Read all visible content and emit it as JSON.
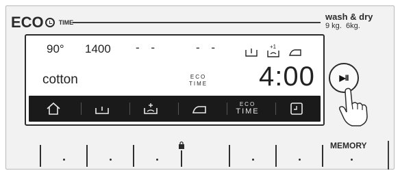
{
  "brand": {
    "eco": "ECO",
    "time": "TIME"
  },
  "capacity": {
    "title": "wash & dry",
    "wash_kg": "9 kg.",
    "dry_kg": "6kg."
  },
  "display": {
    "temperature": "90°",
    "spin_speed": "1400",
    "dash_a": "- -",
    "dash_b": "- -",
    "program": "cotton",
    "eco_label": "ECO",
    "eco_time_label": "TIME",
    "timer": "4:00",
    "plus_one": "+1"
  },
  "toolbar": {
    "items": [
      {
        "name": "home-icon"
      },
      {
        "name": "wash-icon"
      },
      {
        "name": "rinse-icon"
      },
      {
        "name": "iron-icon"
      },
      {
        "name": "eco-time",
        "line1": "ECO",
        "line2": "TIME"
      },
      {
        "name": "delay-start-icon"
      }
    ]
  },
  "controls": {
    "play_pause_symbol": "▶II",
    "memory_label": "MEMORY"
  },
  "colors": {
    "panel_bg": "#f2f2f2",
    "lcd_bg": "#ffffff",
    "toolbar_bg": "#1a1a1a",
    "ink": "#2a2a2a"
  }
}
